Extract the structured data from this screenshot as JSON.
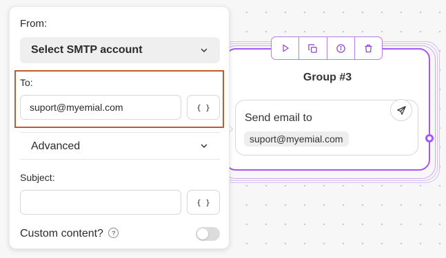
{
  "panel": {
    "from_label": "From:",
    "smtp_select": "Select SMTP account",
    "to_label": "To:",
    "to_value": "suport@myemial.com",
    "variables_button": "{ }",
    "advanced_label": "Advanced",
    "subject_label": "Subject:",
    "subject_value": "",
    "custom_content_label": "Custom content?",
    "custom_content_enabled": false
  },
  "group": {
    "title": "Group #3",
    "toolbar_icons": [
      "play-icon",
      "duplicate-icon",
      "info-icon",
      "trash-icon"
    ],
    "block": {
      "title": "Send email to",
      "email": "suport@myemial.com",
      "icon": "send-icon"
    }
  },
  "colors": {
    "accent": "#a855f7",
    "highlight": "#c2582c"
  }
}
